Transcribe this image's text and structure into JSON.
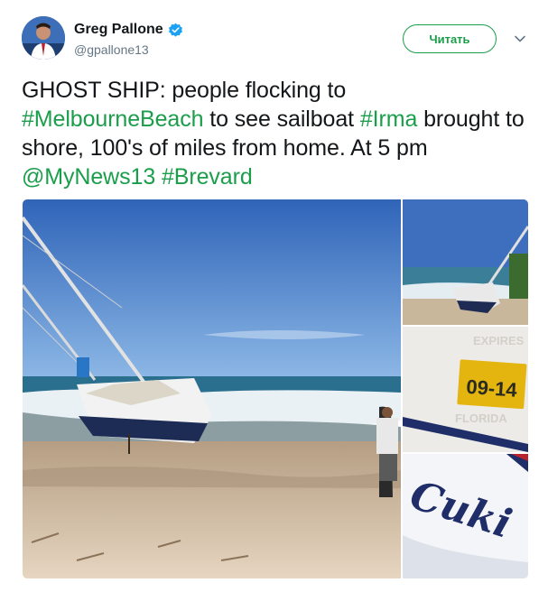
{
  "author": {
    "display_name": "Greg Pallone",
    "handle": "@gpallone13",
    "verified": true,
    "avatar_icon": "avatar-photo"
  },
  "actions": {
    "follow_label": "Читать",
    "more_icon": "chevron-down-icon"
  },
  "tweet": {
    "segments": [
      {
        "text": "GHOST SHIP: people flocking to ",
        "link": false
      },
      {
        "text": "#MelbourneBeach",
        "link": true
      },
      {
        "text": " to see sailboat ",
        "link": false
      },
      {
        "text": "#Irma",
        "link": true
      },
      {
        "text": " brought to shore, 100's of miles from home. At 5 pm ",
        "link": false
      },
      {
        "text": "@MyNews13",
        "link": true
      },
      {
        "text": " ",
        "link": false
      },
      {
        "text": "#Brevard",
        "link": true
      }
    ]
  },
  "media": {
    "photos": [
      {
        "name": "beached-sailboat-photo"
      },
      {
        "name": "sailboat-shore-photo"
      },
      {
        "name": "registration-sticker-photo",
        "sticker_text": "09-14",
        "hull_text_top": "EXPIRES",
        "hull_text_bottom": "FLORIDA"
      },
      {
        "name": "hull-name-photo",
        "hull_text": "Cuki"
      }
    ]
  },
  "colors": {
    "link": "#1b9e4b",
    "verified": "#1da1f2",
    "text": "#14171a",
    "secondary": "#657786"
  }
}
